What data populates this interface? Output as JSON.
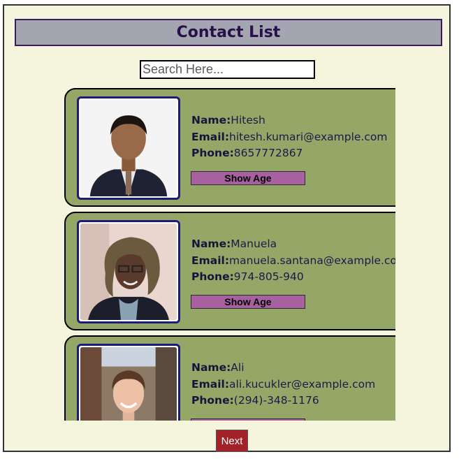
{
  "header": {
    "title": "Contact List"
  },
  "search": {
    "placeholder": "Search Here..."
  },
  "labels": {
    "name": "Name:",
    "email": "Email:",
    "phone": "Phone:",
    "show_age": "Show Age"
  },
  "contacts": [
    {
      "name": "Hitesh",
      "email": "hitesh.kumari@example.com",
      "phone": "8657772867",
      "avatar": "portrait-photo"
    },
    {
      "name": "Manuela",
      "email": "manuela.santana@example.com",
      "phone": "974-805-940",
      "avatar": "portrait-photo"
    },
    {
      "name": "Ali",
      "email": "ali.kucukler@example.com",
      "phone": "(294)-348-1176",
      "avatar": "portrait-photo"
    }
  ],
  "pagination": {
    "next_label": "Next"
  },
  "colors": {
    "page_bg": "#f5f4dc",
    "header_bg": "#a3a6b1",
    "card_bg": "#94a767",
    "button_bg": "#a760a0",
    "next_bg": "#a32227"
  }
}
